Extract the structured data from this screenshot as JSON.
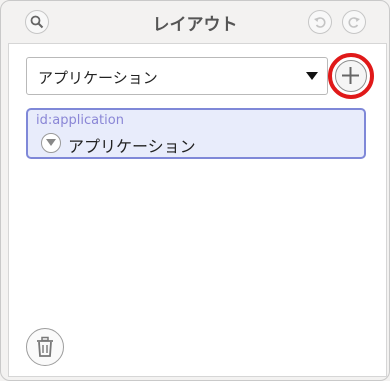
{
  "window": {
    "title": "レイアウト"
  },
  "toolbar": {
    "search_icon": "search-icon",
    "undo_icon": "undo-icon",
    "redo_icon": "redo-icon"
  },
  "layout_select": {
    "selected": "アプリケーション"
  },
  "add_button": {
    "icon": "plus-icon",
    "highlight_color": "#e01919"
  },
  "layout_items": [
    {
      "id_label": "id:application",
      "name": "アプリケーション",
      "selected": true
    }
  ],
  "delete_button": {
    "icon": "trash-icon"
  },
  "colors": {
    "selected_bg": "#e8ecfb",
    "selected_border": "#7f88d8",
    "id_text": "#8a86d6"
  }
}
